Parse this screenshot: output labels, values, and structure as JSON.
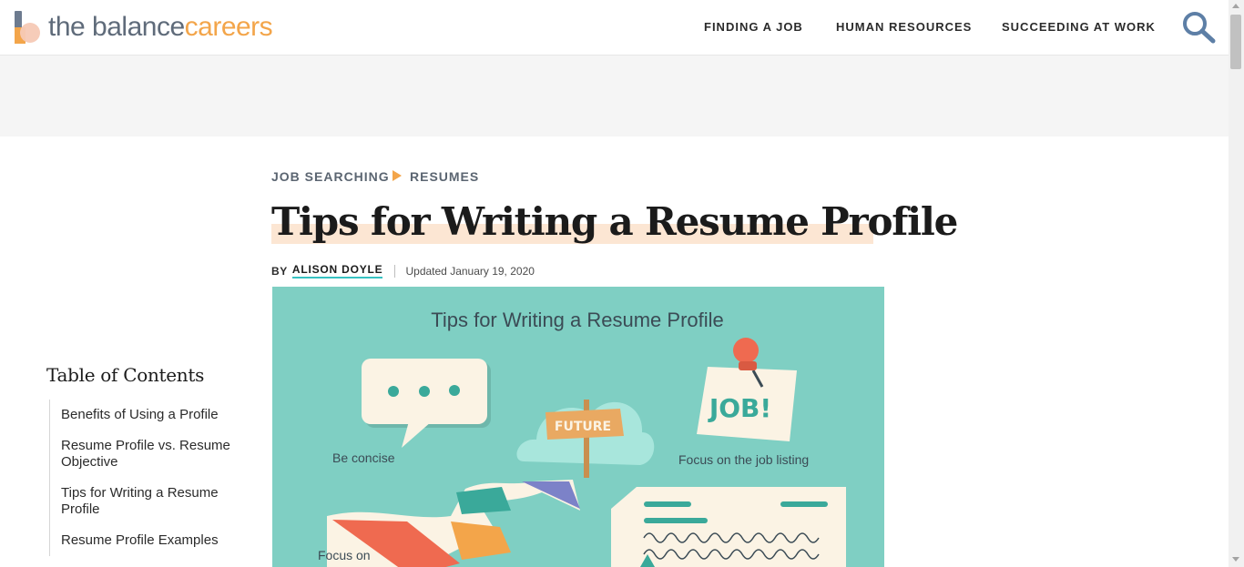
{
  "header": {
    "logo": {
      "part1": "the balance",
      "part2": "careers",
      "brand_gray": "#5f6b7a",
      "brand_orange": "#f3a54a"
    },
    "nav": [
      "FINDING A JOB",
      "HUMAN RESOURCES",
      "SUCCEEDING AT WORK"
    ],
    "search_icon": "search-icon"
  },
  "breadcrumb": [
    "JOB SEARCHING",
    "RESUMES"
  ],
  "article": {
    "title": "Tips for Writing a Resume Profile",
    "byline": {
      "prefix": "BY",
      "author": "ALISON DOYLE",
      "updated": "Updated January 19, 2020"
    }
  },
  "toc": {
    "title": "Table of Contents",
    "items": [
      "Benefits of Using a Profile",
      "Resume Profile vs. Resume Objective",
      "Tips for Writing a Resume Profile",
      "Resume Profile Examples"
    ]
  },
  "hero": {
    "title": "Tips for Writing a Resume Profile",
    "labels": {
      "concise": "Be concise",
      "job_listing": "Focus on the job listing",
      "focus": "Focus on",
      "sign": "FUTURE",
      "note": "JOB!"
    },
    "background": "#7fcfc3"
  }
}
